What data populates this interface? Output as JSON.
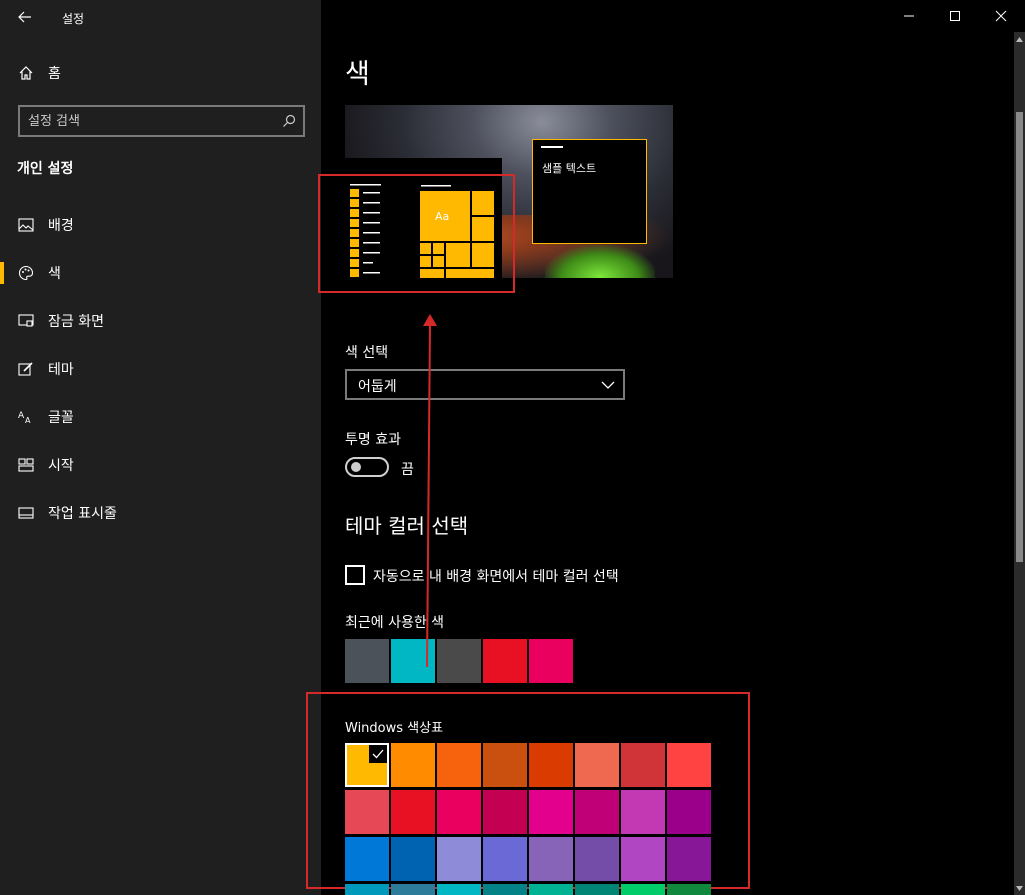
{
  "window": {
    "app_title": "설정",
    "accent_color": "#ffb900",
    "annotation_color": "#d62a2a"
  },
  "sidebar": {
    "home_label": "홈",
    "search_placeholder": "설정 검색",
    "section_title": "개인 설정",
    "items": [
      {
        "label": "배경",
        "icon": "picture-icon"
      },
      {
        "label": "색",
        "icon": "palette-icon"
      },
      {
        "label": "잠금 화면",
        "icon": "lock-screen-icon"
      },
      {
        "label": "테마",
        "icon": "theme-brush-icon"
      },
      {
        "label": "글꼴",
        "icon": "font-icon"
      },
      {
        "label": "시작",
        "icon": "start-tiles-icon"
      },
      {
        "label": "작업 표시줄",
        "icon": "taskbar-icon"
      }
    ],
    "selected_item": "색"
  },
  "main": {
    "title": "색",
    "preview": {
      "sample_text": "샘플 텍스트",
      "tile_text": "Aa"
    },
    "color_choice": {
      "label": "색 선택",
      "value": "어둡게"
    },
    "transparency": {
      "label": "투명 효과",
      "state": "끔"
    },
    "accent_section": {
      "title": "테마 컬러 선택",
      "auto_checkbox_label": "자동으로 내 배경 화면에서 테마 컬러 선택",
      "auto_checked": false
    },
    "recent": {
      "label": "최근에 사용한 색",
      "colors": [
        "#4c5259",
        "#00b7c3",
        "#4a4a4a",
        "#e81123",
        "#ea005e"
      ]
    },
    "palette": {
      "label": "Windows 색상표",
      "selected_index": 0,
      "rows": [
        [
          "#ffb900",
          "#ff8c00",
          "#f7630c",
          "#ca5010",
          "#da3b01",
          "#ef6950",
          "#d13438",
          "#ff4343"
        ],
        [
          "#e74856",
          "#e81123",
          "#ea005e",
          "#c30052",
          "#e3008c",
          "#bf0077",
          "#c239b3",
          "#9a0089"
        ],
        [
          "#0078d7",
          "#0063b1",
          "#8e8cd8",
          "#6b69d6",
          "#8764b8",
          "#744da9",
          "#b146c2",
          "#881798"
        ],
        [
          "#0099bc",
          "#2d7d9a",
          "#00b7c3",
          "#038387",
          "#00b294",
          "#018574",
          "#00cc6a",
          "#10893e"
        ]
      ]
    }
  }
}
